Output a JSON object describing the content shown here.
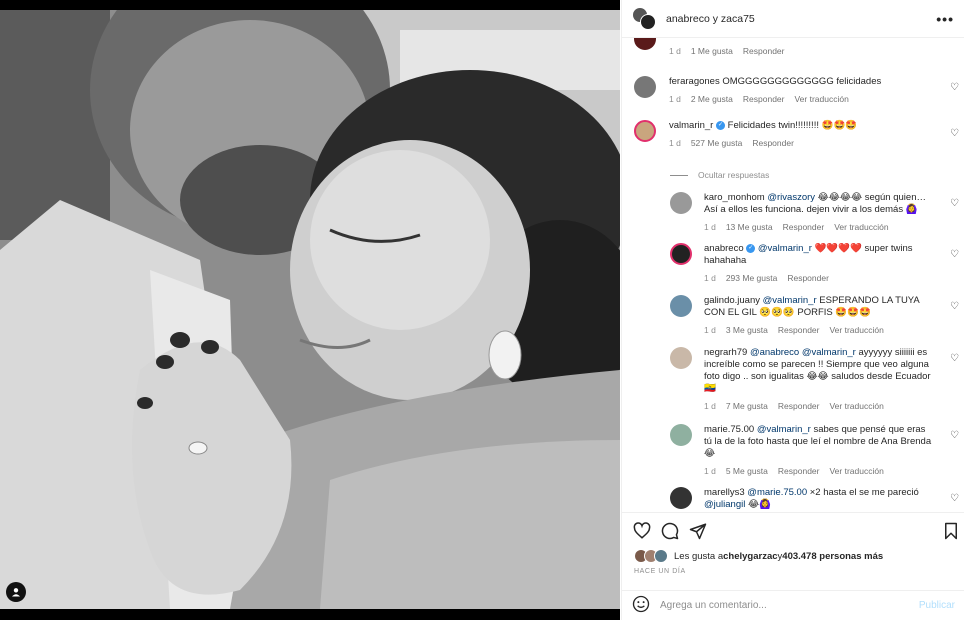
{
  "header": {
    "user1": "anabreco",
    "connector": " y ",
    "user2": "zaca75"
  },
  "comments": [
    {
      "id": 0,
      "user": "",
      "text": "",
      "meta_time": "1 d",
      "meta_likes": "1 Me gusta",
      "meta_reply": "Responder",
      "meta_translate": ""
    },
    {
      "id": 1,
      "user": "feraragones",
      "text": " OMGGGGGGGGGGGGG felicidades",
      "meta_time": "1 d",
      "meta_likes": "2 Me gusta",
      "meta_reply": "Responder",
      "meta_translate": "Ver traducción"
    },
    {
      "id": 2,
      "user": "valmarin_r",
      "text": " Felicidades twin!!!!!!!!! 🤩🤩🤩",
      "meta_time": "1 d",
      "meta_likes": "527 Me gusta",
      "meta_reply": "Responder",
      "meta_translate": ""
    }
  ],
  "hidden_replies": "Ocultar respuestas",
  "replies": [
    {
      "user": "karo_monhom",
      "mention": "@rivaszory",
      "text": " 😂😂😂😂 según quien… Así a ellos les funciona. dejen vivir a los demás 🙆‍♀️",
      "meta_time": "1 d",
      "meta_likes": "13 Me gusta",
      "meta_reply": "Responder",
      "meta_translate": "Ver traducción"
    },
    {
      "user": "anabreco",
      "mention": "@valmarin_r",
      "text": " ❤️❤️❤️❤️ super twins hahahaha",
      "meta_time": "1 d",
      "meta_likes": "293 Me gusta",
      "meta_reply": "Responder",
      "meta_translate": ""
    },
    {
      "user": "galindo.juany",
      "mention": "@valmarin_r",
      "text": " ESPERANDO LA TUYA CON EL GIL 🥺🥺🥺 PORFIS 🤩🤩🤩",
      "meta_time": "1 d",
      "meta_likes": "3 Me gusta",
      "meta_reply": "Responder",
      "meta_translate": "Ver traducción"
    },
    {
      "user": "negrarh79",
      "mention": "@anabreco @valmarin_r",
      "text": " ayyyyyy siiiiiii es increíble como se parecen !! Siempre que veo alguna foto digo .. son igualitas 😂😂 saludos desde Ecuador 🇪🇨",
      "meta_time": "1 d",
      "meta_likes": "7 Me gusta",
      "meta_reply": "Responder",
      "meta_translate": "Ver traducción"
    },
    {
      "user": "marie.75.00",
      "mention": "@valmarin_r",
      "text": " sabes que pensé que eras tú la de la foto hasta que leí el nombre de Ana Brenda 😂",
      "meta_time": "1 d",
      "meta_likes": "5 Me gusta",
      "meta_reply": "Responder",
      "meta_translate": "Ver traducción"
    },
    {
      "user": "marellys3",
      "mention": "@marie.75.00",
      "text": " ×2 hasta el se me pareció",
      "mention2": "@juliangil",
      "text2": " 😂🙆‍♀️",
      "meta_time": "",
      "meta_likes": "",
      "meta_reply": "",
      "meta_translate": ""
    }
  ],
  "likes": {
    "prefix": "Les gusta a ",
    "user": "chelygarzac",
    "mid": " y ",
    "count": "403.478 personas más"
  },
  "ago": "HACE UN DÍA",
  "add_comment": {
    "placeholder": "Agrega un comentario...",
    "publish": "Publicar"
  },
  "icons": {
    "heart": "heart-icon",
    "comment": "comment-icon",
    "share": "share-icon",
    "bookmark": "bookmark-icon",
    "emoji": "emoji-icon",
    "more": "more-icon",
    "user-tag": "user-tag-icon"
  },
  "colors": {
    "link": "#00376b",
    "meta": "#8e8e8e",
    "publish_disabled": "#b2dffc",
    "verified": "#3897f0"
  }
}
